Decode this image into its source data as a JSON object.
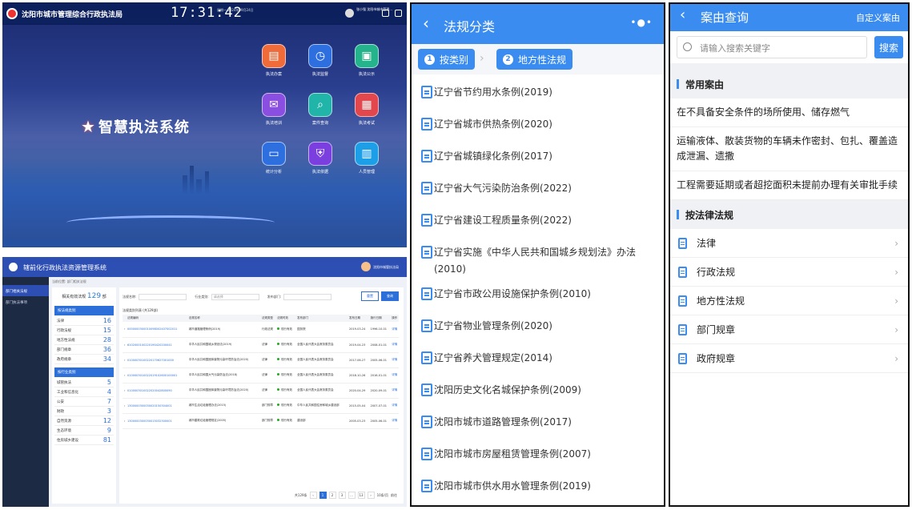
{
  "portal": {
    "title": "沈阳市城市管理综合行政执法局",
    "clock": "17:31:42",
    "date": "星期一 2024年09月24日",
    "user": "张小强 沈阳市城市管理...",
    "brand": "智慧执法系统",
    "tiles": [
      {
        "label": "执法办案",
        "color": "#ef6b3a",
        "icon": "case-icon"
      },
      {
        "label": "执法监督",
        "color": "#2e6fe0",
        "icon": "clock-icon"
      },
      {
        "label": "执法公示",
        "color": "#25b38c",
        "icon": "publicity-icon"
      },
      {
        "label": "执法培训",
        "color": "#8a4fe0",
        "icon": "training-icon"
      },
      {
        "label": "案件查询",
        "color": "#20b5a8",
        "icon": "search-icon"
      },
      {
        "label": "执法考试",
        "color": "#e2474d",
        "icon": "exam-icon"
      },
      {
        "label": "统计分析",
        "color": "#2e6fe0",
        "icon": "chart-icon"
      },
      {
        "label": "执法依据",
        "color": "#7b3fe0",
        "icon": "shield-icon"
      },
      {
        "label": "人员管理",
        "color": "#1d9fe8",
        "icon": "people-icon"
      }
    ]
  },
  "admin": {
    "title": "辖前化行政执法资源管理系统",
    "user": "沈阳市城管执法局",
    "side": [
      "部门相关法规",
      "部门执法事项"
    ],
    "crumb": "当前位置: 部门相关法规",
    "count_label": "相关有效法规",
    "count": "129",
    "count_unit": "部",
    "cat_header": "按法规类别",
    "cats": [
      {
        "n": "法律",
        "v": "16"
      },
      {
        "n": "行政法规",
        "v": "15"
      },
      {
        "n": "地方性法规",
        "v": "28"
      },
      {
        "n": "部门规章",
        "v": "36"
      },
      {
        "n": "政府规章",
        "v": "34"
      }
    ],
    "field_header": "按行业类别",
    "fields": [
      {
        "n": "城管执法",
        "v": "5"
      },
      {
        "n": "工业和信息化",
        "v": "4"
      },
      {
        "n": "公安",
        "v": "7"
      },
      {
        "n": "财政",
        "v": "3"
      },
      {
        "n": "自然资源",
        "v": "12"
      },
      {
        "n": "生态环境",
        "v": "9"
      },
      {
        "n": "住房城乡建设",
        "v": "81"
      }
    ],
    "filters": [
      "法规名称:",
      "行业类别:",
      "发布部门:"
    ],
    "filter_value": "请选择",
    "btn_reset": "重置",
    "btn_query": "查询",
    "table_title": "法规类别列表 (共129部)",
    "cols": [
      "法规编码",
      "法规名称",
      "法规类型",
      "法规时效",
      "发布部门",
      "发布日期",
      "施行日期",
      "操作"
    ],
    "rows": [
      [
        "0000000300010098002407002011",
        "城市道路管理条例(2019)",
        "行政法规",
        "现行有效",
        "国务院",
        "2019-03-24",
        "1996-10-01",
        "详情"
      ],
      [
        "6102000100220190420200041",
        "中华人民共和国城乡规划法(2019)",
        "法律",
        "现行有效",
        "全国人民代表大会常务委员会",
        "2019-04-23",
        "2008-01-01",
        "详情"
      ],
      [
        "01000030100220170627001000",
        "中华人民共和国固体废物污染环境防治法(2020)",
        "法律",
        "现行有效",
        "全国人民代表大会常务委员会",
        "2017-06-27",
        "2005-06-01",
        "详情"
      ],
      [
        "0100003010022019102600100001",
        "中华人民共和国大气污染防治法(2018)",
        "法律",
        "现行有效",
        "全国人民代表大会常务委员会",
        "2018-10-26",
        "2016-01-01",
        "详情"
      ],
      [
        "0100003010022020042800090",
        "中华人民共和国固体废物污染环境防治法(2020)",
        "法律",
        "现行有效",
        "全国人民代表大会常务委员会",
        "2020-04-29",
        "2020-09-01",
        "详情"
      ],
      [
        "1300000300030020150304001",
        "城市生活垃圾管理办法(2015)",
        "部门规章",
        "现行有效",
        "中华人民共和国住房和城乡建设部",
        "2015-05-04",
        "2007-07-01",
        "详情"
      ],
      [
        "1300000300030015032300001",
        "城市建筑垃圾管理规定(2005)",
        "部门规章",
        "现行有效",
        "建设部",
        "2005-03-23",
        "2005-06-01",
        "详情"
      ]
    ],
    "pager": {
      "total": "共129条",
      "pages": [
        "1",
        "2",
        "3",
        "...",
        "13"
      ],
      "size": "10条/页",
      "goto": "前往"
    }
  },
  "laws": {
    "title": "法规分类",
    "step1": "按类别",
    "step2": "地方性法规",
    "items": [
      "辽宁省节约用水条例(2019)",
      "辽宁省城市供热条例(2020)",
      "辽宁省城镇绿化条例(2017)",
      "辽宁省大气污染防治条例(2022)",
      "辽宁省建设工程质量条例(2022)",
      "辽宁省实施《中华人民共和国城乡规划法》办法(2010)",
      "辽宁省市政公用设施保护条例(2010)",
      "辽宁省物业管理条例(2020)",
      "辽宁省养犬管理规定(2014)",
      "沈阳历史文化名城保护条例(2009)",
      "沈阳市城市道路管理条例(2017)",
      "沈阳市城市房屋租赁管理条例(2007)",
      "沈阳市城市供水用水管理条例(2019)"
    ]
  },
  "cases": {
    "title": "案由查询",
    "custom": "自定义案由",
    "placeholder": "请输入搜索关键字",
    "search": "搜索",
    "common": "常用案由",
    "common_items": [
      "在不具备安全条件的场所使用、储存燃气",
      "运输液体、散装货物的车辆未作密封、包扎、覆盖造成泄漏、遗撒",
      "工程需要延期或者超挖面积未提前办理有关审批手续"
    ],
    "by_law": "按法律法规",
    "law_items": [
      "法律",
      "行政法规",
      "地方性法规",
      "部门规章",
      "政府规章"
    ]
  }
}
